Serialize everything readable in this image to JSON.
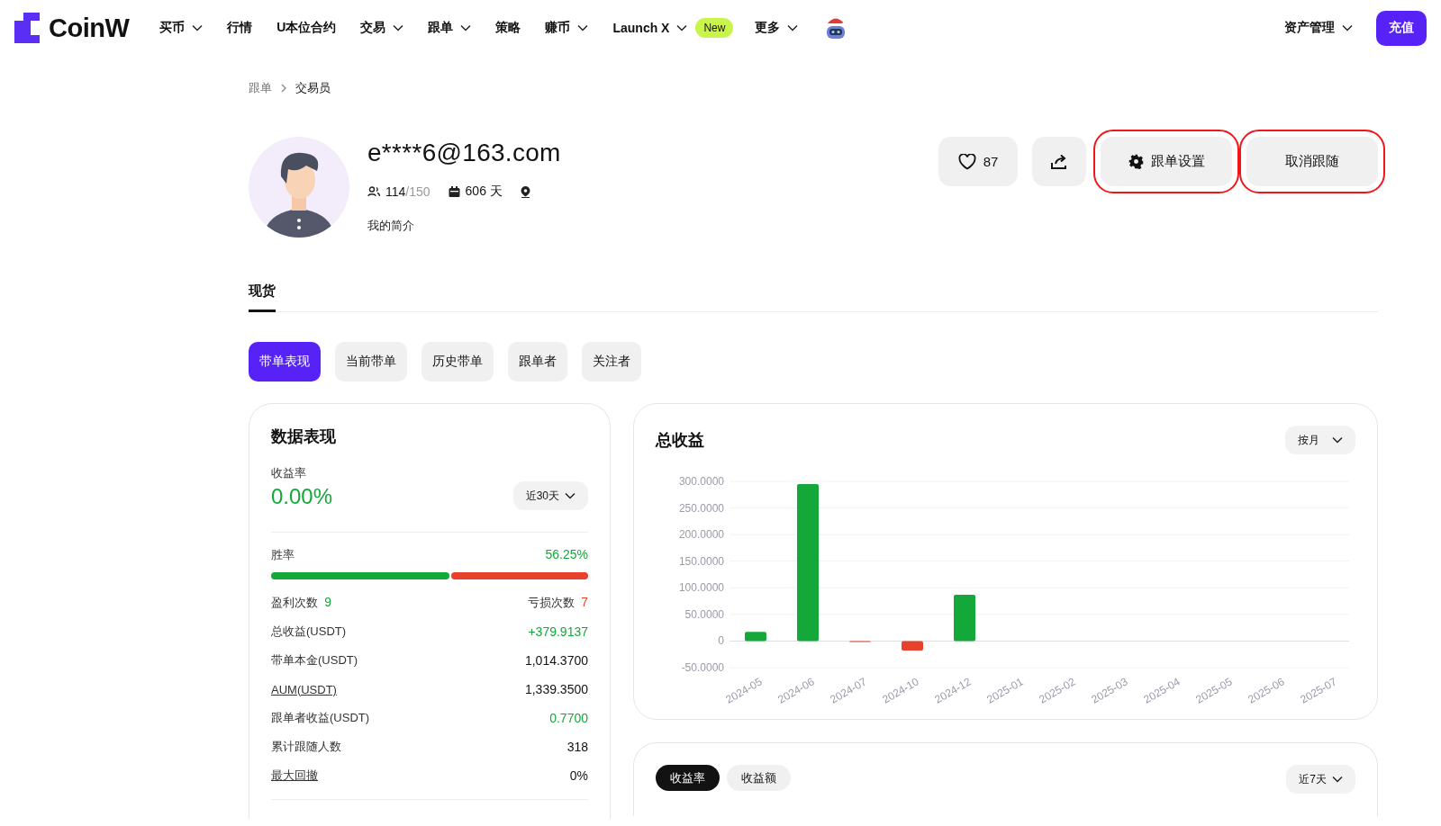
{
  "nav": {
    "logo": "CoinW",
    "items": [
      {
        "label": "买币",
        "dropdown": true
      },
      {
        "label": "行情",
        "dropdown": false
      },
      {
        "label": "U本位合约",
        "dropdown": false
      },
      {
        "label": "交易",
        "dropdown": true
      },
      {
        "label": "跟单",
        "dropdown": true
      },
      {
        "label": "策略",
        "dropdown": false
      },
      {
        "label": "赚币",
        "dropdown": true
      },
      {
        "label": "Launch X",
        "dropdown": true,
        "badge": "New"
      },
      {
        "label": "更多",
        "dropdown": true
      }
    ],
    "asset_menu": {
      "label": "资产管理",
      "dropdown": true
    },
    "deposit_button": "充值"
  },
  "breadcrumb": [
    "跟单",
    "交易员"
  ],
  "trader": {
    "name": "e****6@163.com",
    "followers": "114",
    "capacity": "/150",
    "days": "606 天",
    "bio": "我的简介",
    "likes": "87"
  },
  "actions": [
    {
      "label": "跟单设置",
      "kind": "settings",
      "highlighted": true
    },
    {
      "label": "取消跟随",
      "kind": "plain",
      "highlighted": true
    }
  ],
  "market_tabs": [
    {
      "label": "现货",
      "selected": true
    }
  ],
  "section_tabs": [
    {
      "label": "带单表现",
      "selected": true
    },
    {
      "label": "当前带单",
      "selected": false
    },
    {
      "label": "历史带单",
      "selected": false
    },
    {
      "label": "跟单者",
      "selected": false
    },
    {
      "label": "关注者",
      "selected": false
    }
  ],
  "performance": {
    "title": "数据表现",
    "rate_label": "收益率",
    "rate": "0.00%",
    "period": "近30天",
    "win_label": "胜率",
    "win_rate": "56.25%",
    "level": 0.5625,
    "profit_label": "盈利次数",
    "profit_count": "9",
    "loss_label": "亏损次数",
    "loss_count": "7",
    "rows": [
      {
        "label": "总收益(USDT)",
        "value": "+379.9137",
        "positive": true,
        "link": false
      },
      {
        "label": "带单本金(USDT)",
        "value": "1,014.3700",
        "positive": false,
        "link": false
      },
      {
        "label": "AUM(USDT)",
        "value": "1,339.3500",
        "positive": false,
        "link": true
      },
      {
        "label": "跟单者收益(USDT)",
        "value": "0.7700",
        "positive": true,
        "link": false
      },
      {
        "label": "累计跟随人数",
        "value": "318",
        "positive": false,
        "link": false
      },
      {
        "label": "最大回撤",
        "value": "0%",
        "positive": false,
        "link": true
      }
    ]
  },
  "total_profit": {
    "title": "总收益",
    "period": "按月",
    "chart_data": {
      "type": "bar",
      "categories": [
        "2024-05",
        "2024-06",
        "2024-07",
        "2024-10",
        "2024-12",
        "2025-01",
        "2025-02",
        "2025-03",
        "2025-04",
        "2025-05",
        "2025-06",
        "2025-07"
      ],
      "values": [
        17,
        295,
        -1,
        -18,
        87,
        0,
        0,
        0,
        0,
        0,
        0,
        0
      ],
      "grid": true,
      "ylim": [
        -50,
        300
      ],
      "yticks": [
        {
          "value": 300,
          "label": "300.0000"
        },
        {
          "value": 250,
          "label": "250.0000"
        },
        {
          "value": 200,
          "label": "200.0000"
        },
        {
          "value": 150,
          "label": "150.0000"
        },
        {
          "value": 100,
          "label": "100.0000"
        },
        {
          "value": 50,
          "label": "50.0000"
        },
        {
          "value": 0,
          "label": "0"
        },
        {
          "value": -50,
          "label": "-50.0000"
        }
      ]
    }
  },
  "returns": {
    "tabs": [
      {
        "label": "收益率",
        "selected": true
      },
      {
        "label": "收益额",
        "selected": false
      }
    ],
    "period": "近7天"
  }
}
